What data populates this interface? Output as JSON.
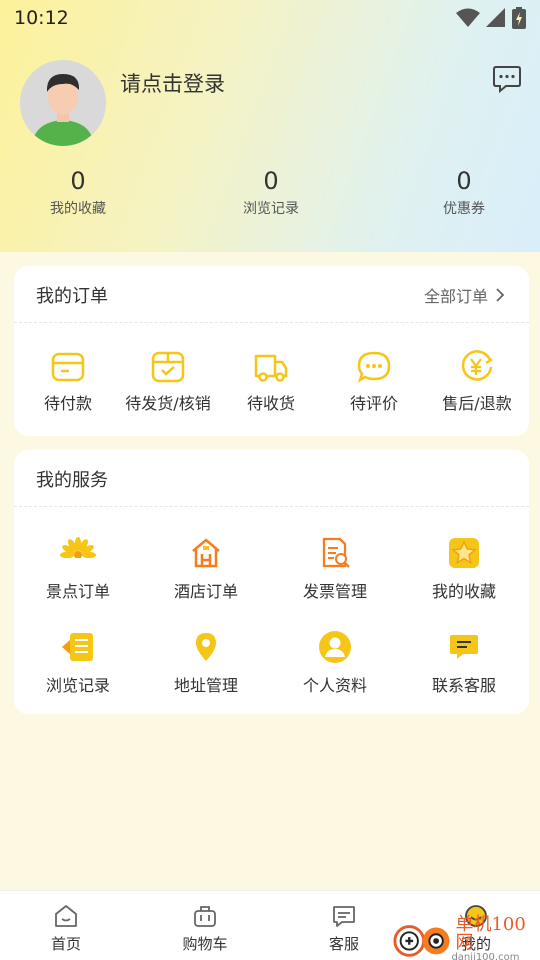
{
  "status_bar": {
    "time": "10:12"
  },
  "profile": {
    "login_prompt": "请点击登录"
  },
  "stats": [
    {
      "count": "0",
      "label": "我的收藏"
    },
    {
      "count": "0",
      "label": "浏览记录"
    },
    {
      "count": "0",
      "label": "优惠券"
    }
  ],
  "orders": {
    "title": "我的订单",
    "all_label": "全部订单",
    "items": [
      {
        "label": "待付款",
        "icon": "wallet-icon"
      },
      {
        "label": "待发货/核销",
        "icon": "package-check-icon"
      },
      {
        "label": "待收货",
        "icon": "truck-icon"
      },
      {
        "label": "待评价",
        "icon": "chat-bubble-icon"
      },
      {
        "label": "售后/退款",
        "icon": "yen-refund-icon"
      }
    ]
  },
  "services": {
    "title": "我的服务",
    "items": [
      {
        "label": "景点订单",
        "icon": "flower-icon"
      },
      {
        "label": "酒店订单",
        "icon": "hotel-icon"
      },
      {
        "label": "发票管理",
        "icon": "invoice-icon"
      },
      {
        "label": "我的收藏",
        "icon": "star-icon"
      },
      {
        "label": "浏览记录",
        "icon": "history-list-icon"
      },
      {
        "label": "地址管理",
        "icon": "location-pin-icon"
      },
      {
        "label": "个人资料",
        "icon": "person-icon"
      },
      {
        "label": "联系客服",
        "icon": "service-chat-icon"
      }
    ]
  },
  "tabbar": [
    {
      "label": "首页",
      "icon": "home-icon"
    },
    {
      "label": "购物车",
      "icon": "cart-icon"
    },
    {
      "label": "客服",
      "icon": "message-icon"
    },
    {
      "label": "我的",
      "icon": "smiley-icon"
    }
  ],
  "watermark": {
    "brand": "单机100网",
    "domain": "danji100.com"
  },
  "colors": {
    "accent": "#f5c518",
    "orange": "#f57c1f",
    "page_bg": "#fdf8e1"
  }
}
